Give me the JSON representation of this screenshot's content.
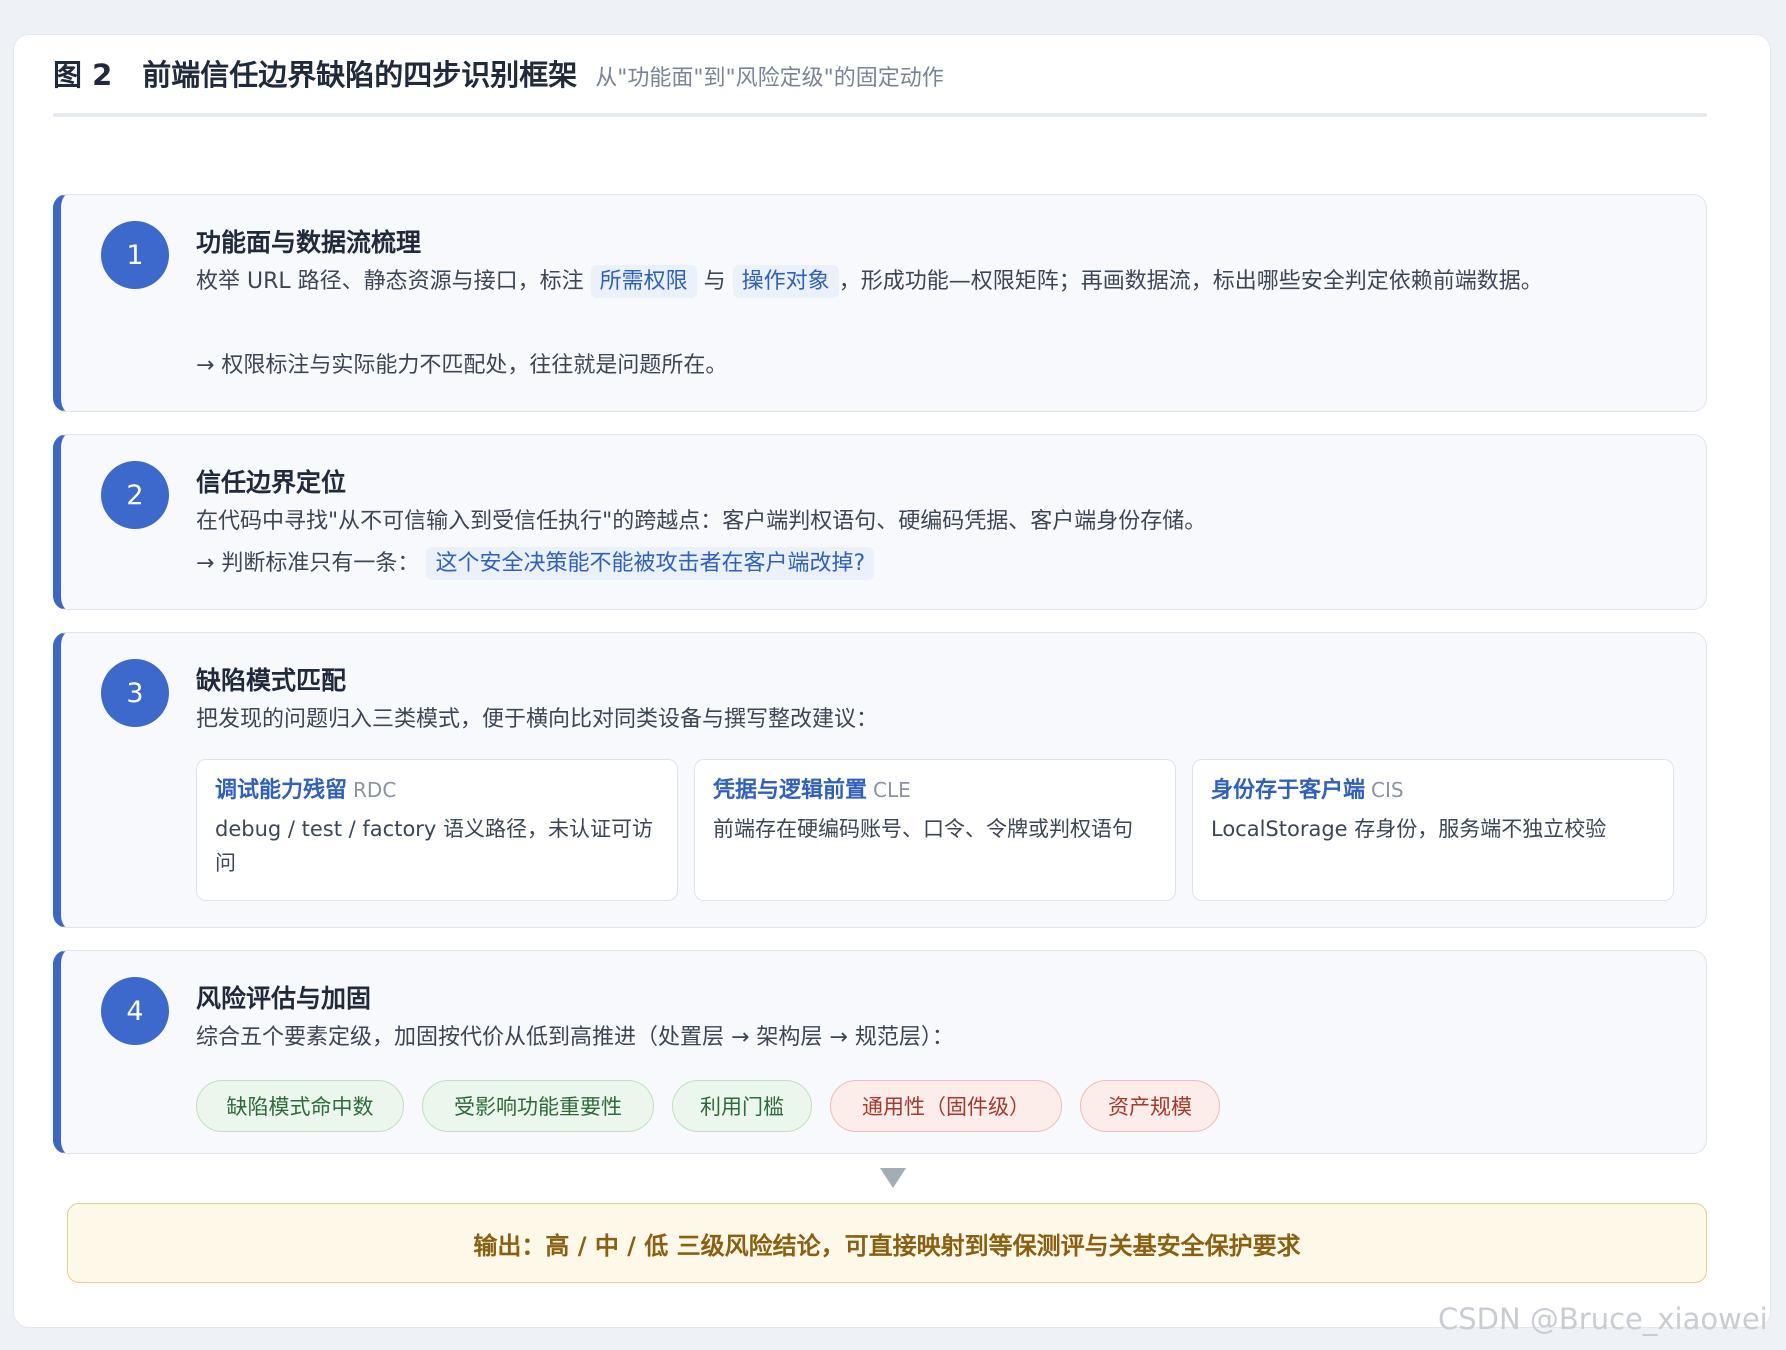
{
  "header": {
    "fig_num": "图 2",
    "title": "前端信任边界缺陷的四步识别框架",
    "subtitle": "从\"功能面\"到\"风险定级\"的固定动作"
  },
  "steps": [
    {
      "num": "1",
      "title": "功能面与数据流梳理",
      "text_a": "枚举 URL 路径、静态资源与接口，标注",
      "hl_a": "所需权限",
      "text_b": "与",
      "hl_b": "操作对象",
      "text_c": "，形成功能—权限矩阵；再画数据流，标出哪些安全判定依赖前端数据。",
      "note": "→ 权限标注与实际能力不匹配处，往往就是问题所在。"
    },
    {
      "num": "2",
      "title": "信任边界定位",
      "text": "在代码中寻找\"从不可信输入到受信任执行\"的跨越点：客户端判权语句、硬编码凭据、客户端身份存储。",
      "note_prefix": "→ 判断标准只有一条：",
      "note_hl": "这个安全决策能不能被攻击者在客户端改掉?"
    },
    {
      "num": "3",
      "title": "缺陷模式匹配",
      "text": "把发现的问题归入三类模式，便于横向比对同类设备与撰写整改建议：",
      "patterns": [
        {
          "name": "调试能力残留",
          "code": "RDC",
          "desc": "debug / test / factory 语义路径，未认证可访问"
        },
        {
          "name": "凭据与逻辑前置",
          "code": "CLE",
          "desc": "前端存在硬编码账号、口令、令牌或判权语句"
        },
        {
          "name": "身份存于客户端",
          "code": "CIS",
          "desc": "LocalStorage 存身份，服务端不独立校验"
        }
      ]
    },
    {
      "num": "4",
      "title": "风险评估与加固",
      "text": "综合五个要素定级，加固按代价从低到高推进（处置层 → 架构层 → 规范层）：",
      "tags": [
        {
          "label": "缺陷模式命中数",
          "tone": "green"
        },
        {
          "label": "受影响功能重要性",
          "tone": "green"
        },
        {
          "label": "利用门槛",
          "tone": "green"
        },
        {
          "label": "通用性（固件级）",
          "tone": "red"
        },
        {
          "label": "资产规模",
          "tone": "red"
        }
      ]
    }
  ],
  "output": "输出：高 / 中 / 低 三级风险结论，可直接映射到等保测评与关基安全保护要求",
  "watermark": "CSDN @Bruce_xiaowei",
  "colors": {
    "accent": "#3c66c8",
    "tag_green_bg": "#ebf6ec",
    "tag_red_bg": "#fcecea",
    "output_bg": "#fdf8e8"
  }
}
